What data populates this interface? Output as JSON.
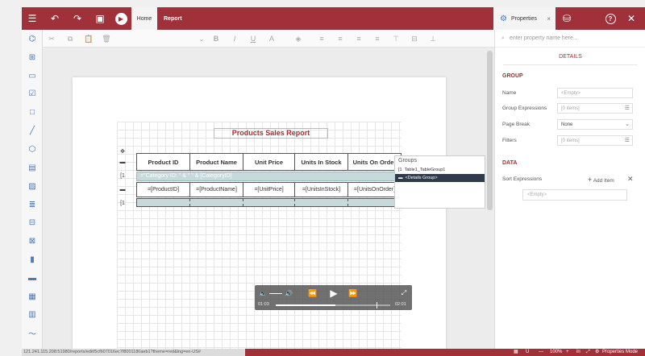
{
  "topbar": {
    "tab_home": "Home",
    "tab_report": "Report",
    "properties_tab": "Properties",
    "properties_close": "×"
  },
  "properties": {
    "search_placeholder": "enter property name here...",
    "details_tab": "DETAILS",
    "group_section": "GROUP",
    "rows": [
      {
        "label": "Name",
        "value": "<Empty>"
      },
      {
        "label": "Group Expressions",
        "value": "[0 items]"
      },
      {
        "label": "Page Break",
        "value": "None"
      },
      {
        "label": "Filters",
        "value": "[0 items]"
      }
    ],
    "data_section": "DATA",
    "sort_label": "Sort Expressions",
    "add_item": "Add Item",
    "sort_value": "<Empty>"
  },
  "report": {
    "title": "Products Sales Report",
    "headers": [
      "Product ID",
      "Product Name",
      "Unit Price",
      "Units In Stock",
      "Units On Order"
    ],
    "group_expr": "=\"Category ID: \" & \" \" & [CategoryID]",
    "details": [
      "=[ProductID]",
      "=[ProductName]",
      "=[UnitPrice]",
      "=[UnitsInStock]",
      "=[UnitsOnOrder]"
    ]
  },
  "groups_panel": {
    "title": "Groups",
    "items": [
      "Table1_TableGroup1",
      "<Details Group>"
    ]
  },
  "player": {
    "current": "01:03",
    "duration": "02:01",
    "progress": 0.52
  },
  "status": {
    "url": "121.241.115.208:51980/reports/edit/5cf607016ec7f8001180aeb1?theme=red&lng=en-US#",
    "zoom": "100%",
    "units": "in",
    "mode": "Properties Mode"
  },
  "colors": {
    "accent": "#a0303a",
    "group_row": "#c6dadc"
  }
}
